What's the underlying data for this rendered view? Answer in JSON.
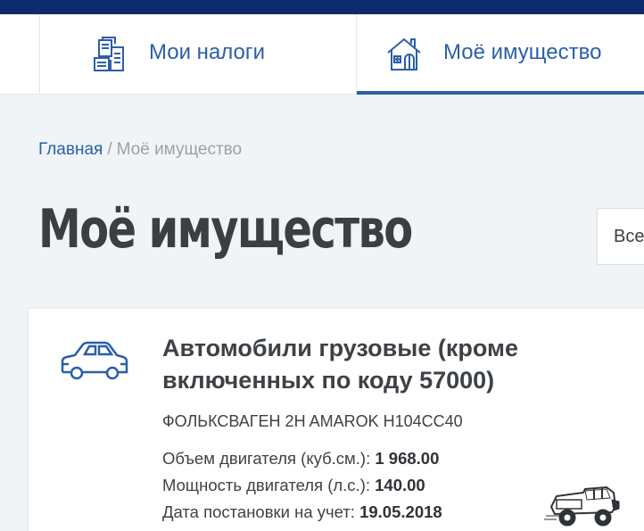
{
  "nav": {
    "tabs": [
      {
        "label": "Мои налоги",
        "icon": "documents-icon"
      },
      {
        "label": "Моё имущество",
        "icon": "house-icon",
        "active": true
      }
    ]
  },
  "breadcrumb": {
    "home": "Главная",
    "separator": "/",
    "current": "Моё имущество"
  },
  "page": {
    "title": "Моё имущество"
  },
  "filter": {
    "value": "Все"
  },
  "card": {
    "icon": "car-icon",
    "title": "Автомобили грузовые (кроме включенных по коду 57000)",
    "vehicle_name": "ФОЛЬКСВАГЕН 2H AMAROK Н104СС40",
    "engine_volume_label": "Объем двигателя (куб.см.):",
    "engine_volume_value": "1 968.00",
    "engine_power_label": "Мощность двигателя (л.с.):",
    "engine_power_value": "140.00",
    "registration_label": "Дата постановки на учет:",
    "registration_value": "19.05.2018",
    "image": "truck-icon"
  },
  "colors": {
    "accent": "#2b5fa7",
    "topbar": "#0c2b6b",
    "background": "#f0f4f7"
  }
}
